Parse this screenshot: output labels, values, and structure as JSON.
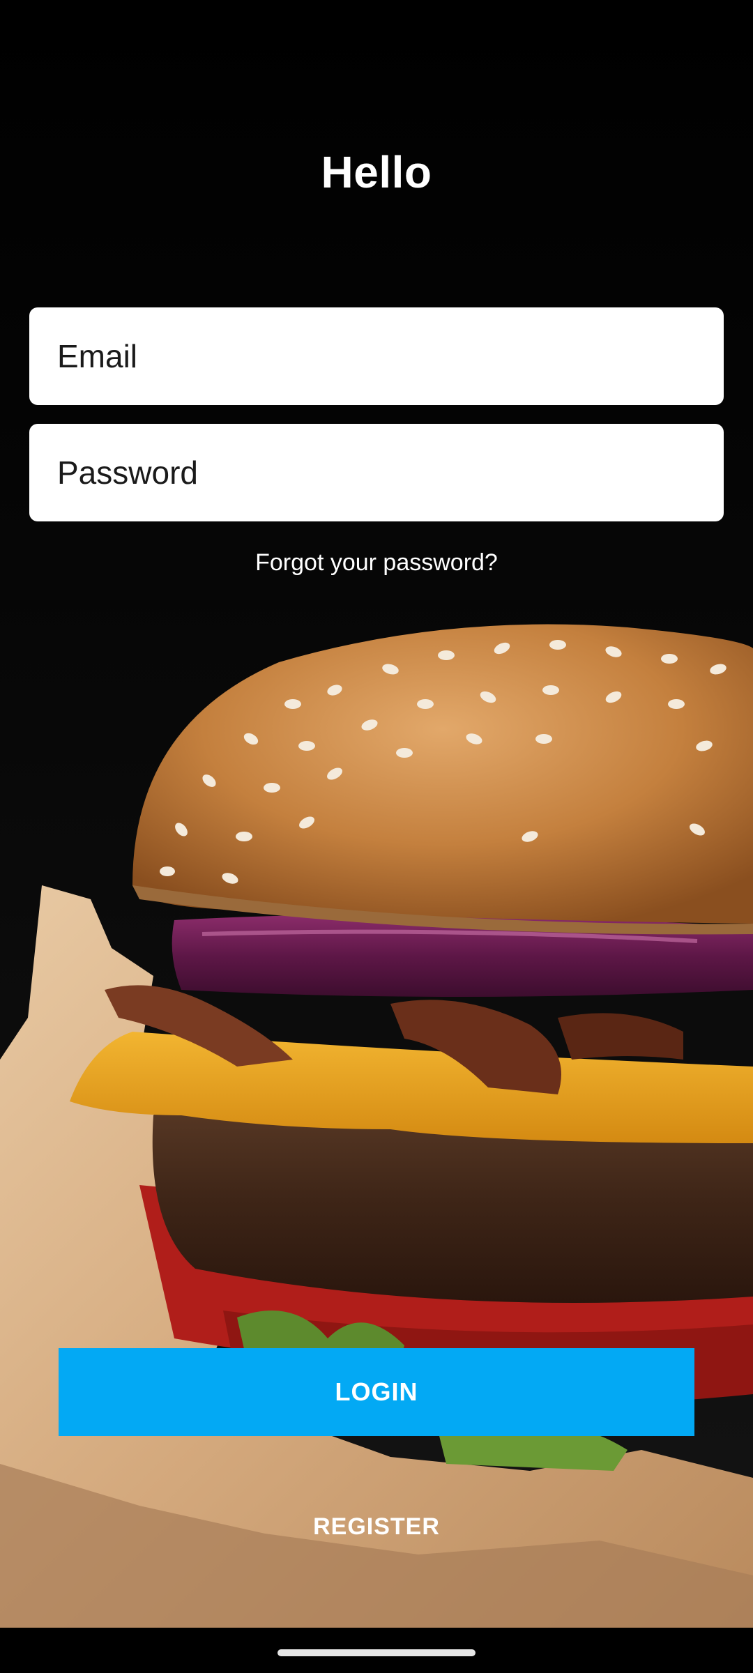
{
  "header": {
    "title": "Hello"
  },
  "form": {
    "email_placeholder": "Email",
    "password_placeholder": "Password",
    "forgot_link": "Forgot your password?"
  },
  "actions": {
    "login_label": "LOGIN",
    "register_label": "REGISTER"
  },
  "colors": {
    "primary": "#03a9f4",
    "background": "#000000",
    "text": "#ffffff"
  },
  "background_image": {
    "icon": "burger-photo"
  }
}
